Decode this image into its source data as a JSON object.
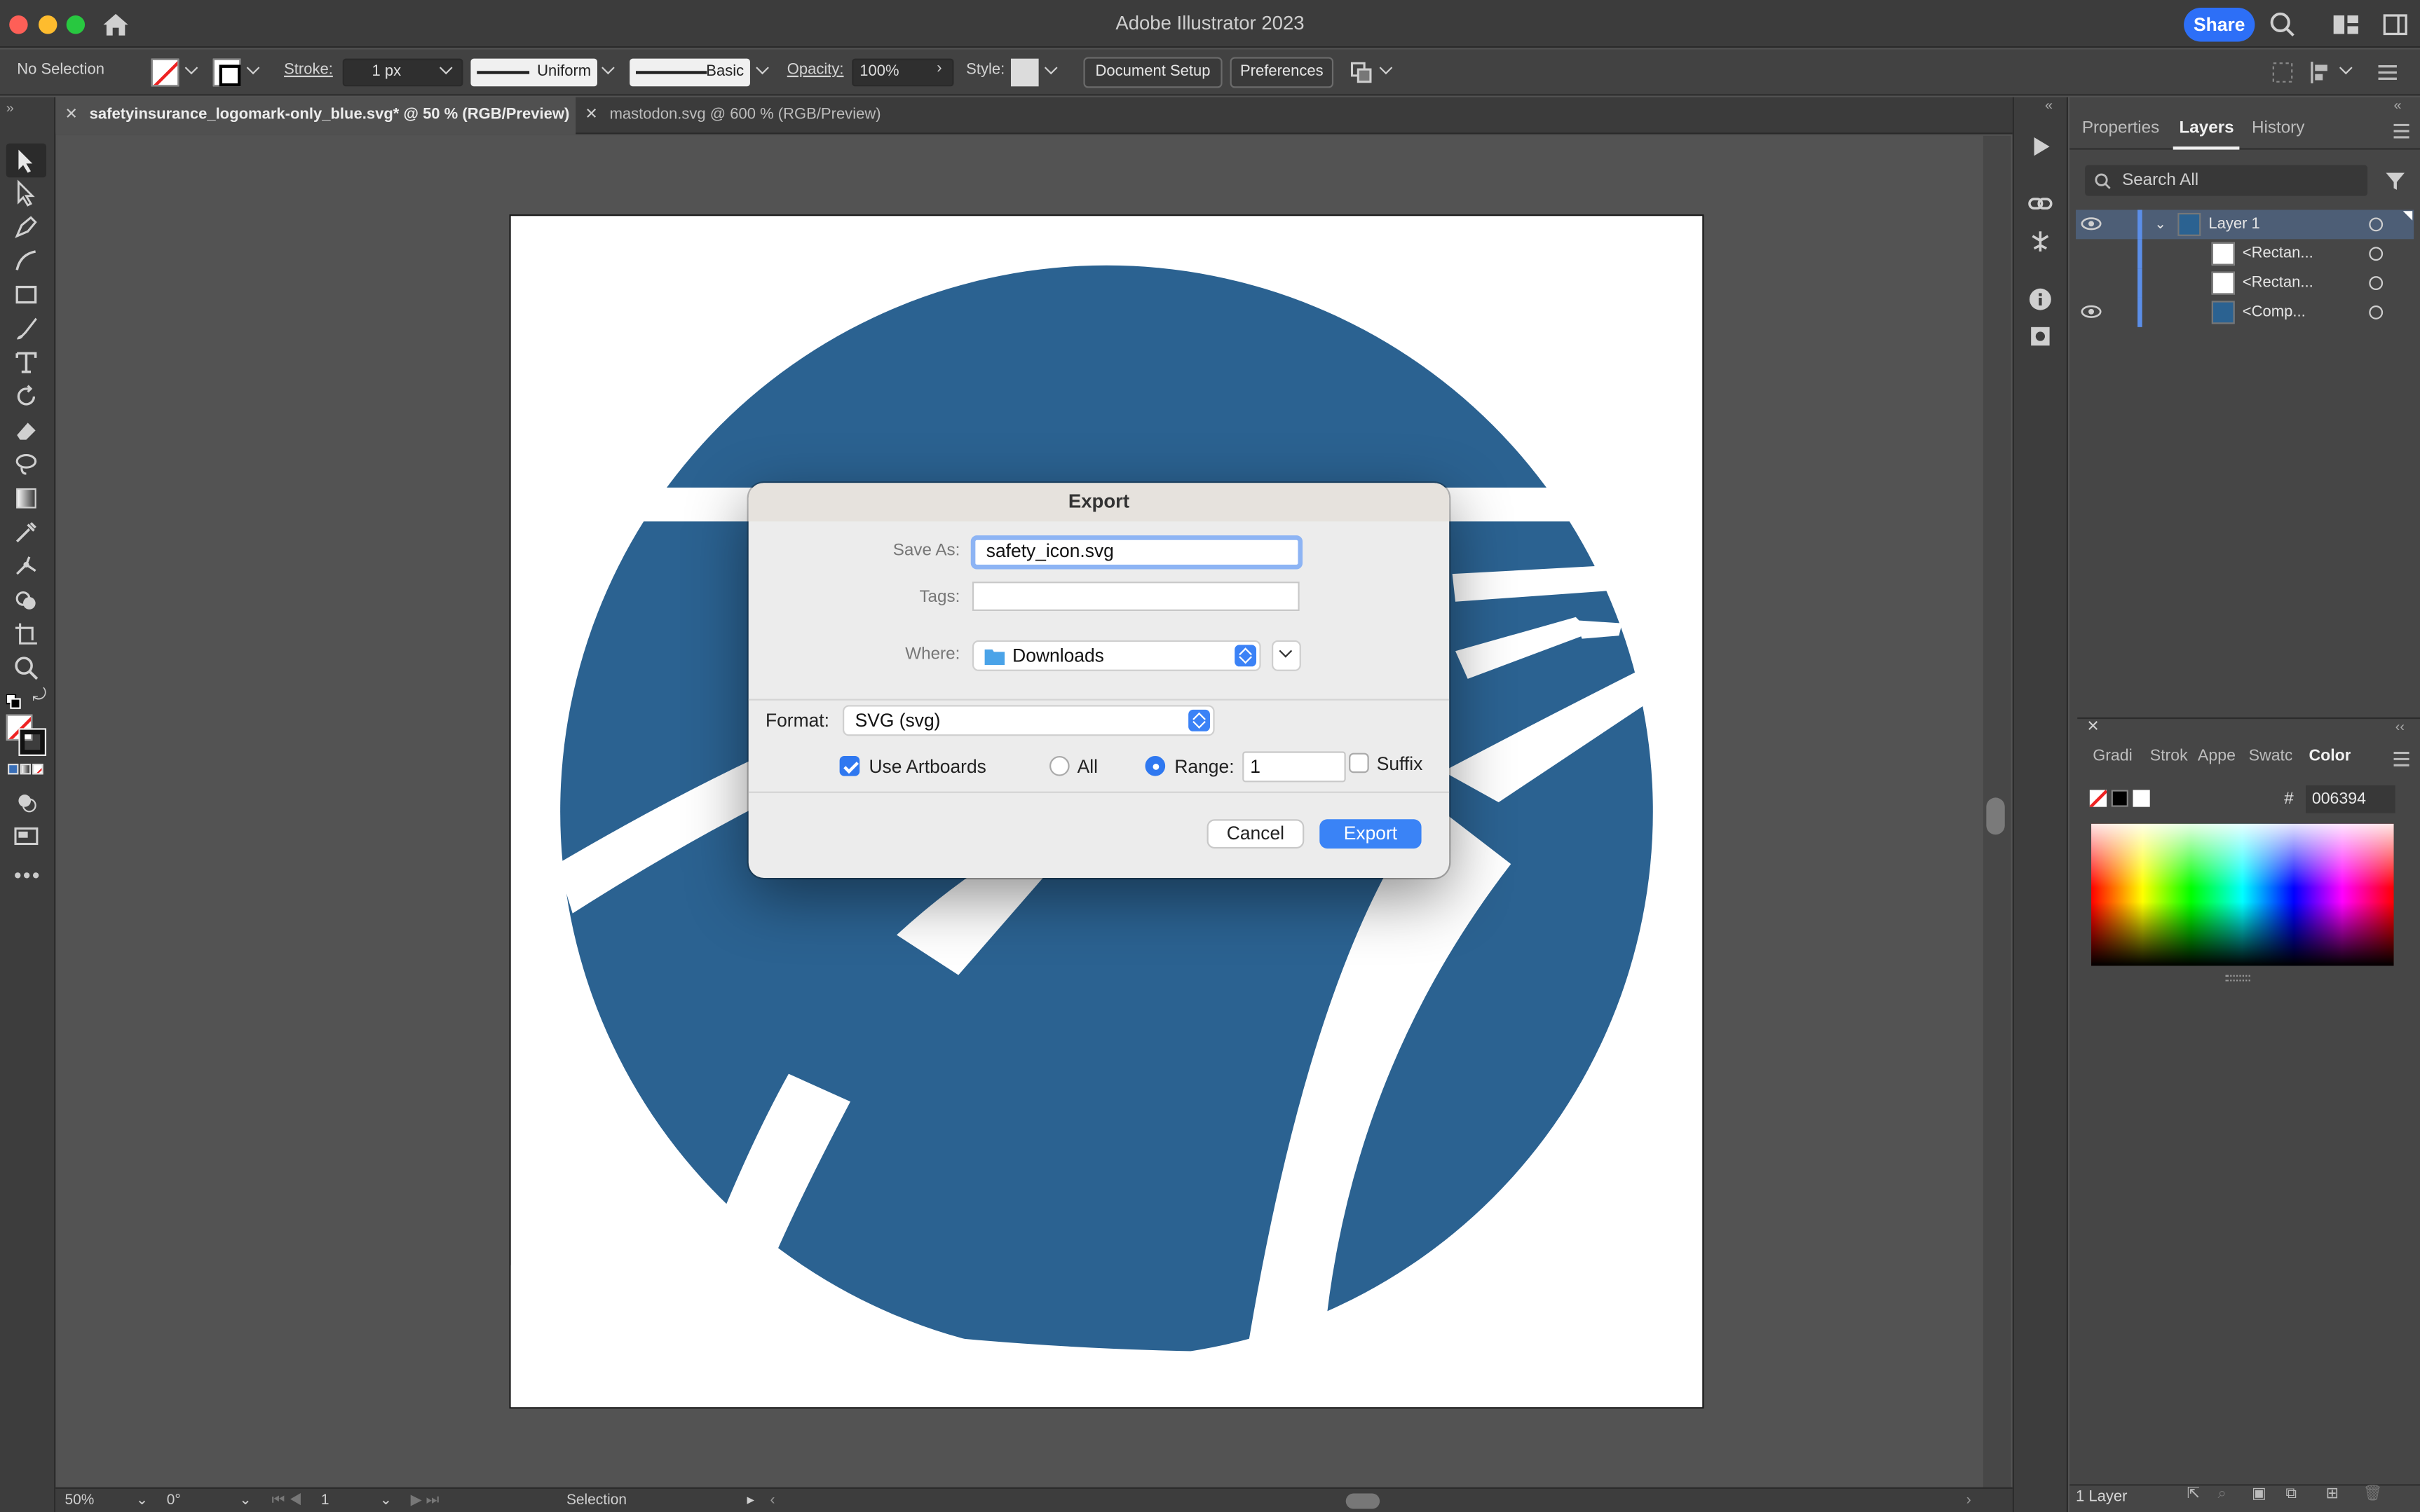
{
  "app": {
    "title": "Adobe Illustrator 2023",
    "share_label": "Share"
  },
  "control_bar": {
    "selection": "No Selection",
    "stroke_label": "Stroke:",
    "stroke_value": "1 px",
    "profile": "Uniform",
    "brush": "Basic",
    "opacity_label": "Opacity:",
    "opacity_value": "100%",
    "style_label": "Style:",
    "document_setup": "Document Setup",
    "preferences": "Preferences"
  },
  "tabs": [
    {
      "label": "safetyinsurance_logomark-only_blue.svg* @ 50 % (RGB/Preview)",
      "active": true
    },
    {
      "label": "mastodon.svg @ 600 % (RGB/Preview)",
      "active": false
    }
  ],
  "status_bar": {
    "zoom": "50%",
    "rotation": "0°",
    "artboard": "1",
    "tool": "Selection"
  },
  "panel_tabs": [
    "Properties",
    "Layers",
    "History"
  ],
  "layers": {
    "search_placeholder": "Search All",
    "rows": [
      {
        "name": "Layer 1"
      },
      {
        "name": "<Rectan..."
      },
      {
        "name": "<Rectan..."
      },
      {
        "name": "<Comp..."
      }
    ],
    "footer_count": "1 Layer"
  },
  "color_panel": {
    "tabs": [
      "Gradi",
      "Strok",
      "Appe",
      "Swatc",
      "Color"
    ],
    "hash": "#",
    "hex": "006394"
  },
  "logo": {
    "color": "#2b6291"
  },
  "export_dialog": {
    "title": "Export",
    "save_as_label": "Save As:",
    "save_as_value": "safety_icon.svg",
    "tags_label": "Tags:",
    "tags_value": "",
    "where_label": "Where:",
    "where_value": "Downloads",
    "format_label": "Format:",
    "format_value": "SVG (svg)",
    "use_artboards": "Use Artboards",
    "all_label": "All",
    "range_label": "Range:",
    "range_value": "1",
    "suffix_label": "Suffix",
    "cancel": "Cancel",
    "export": "Export"
  }
}
